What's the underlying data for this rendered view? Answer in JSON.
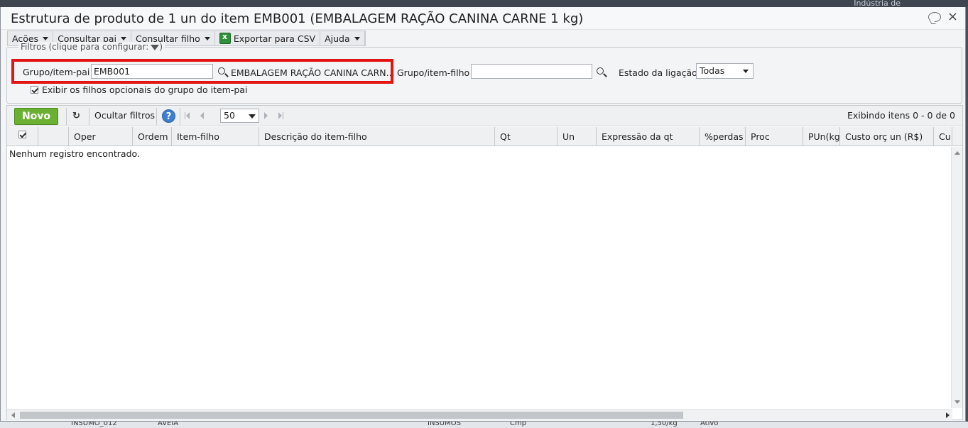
{
  "background": {
    "top_right_text": "Indústria de",
    "bottom_row": [
      "INSUMO_012",
      "AVEIA",
      "INSUMOS",
      "Cmp",
      "1,50/kg",
      "Ativo"
    ]
  },
  "dialog": {
    "title": "Estrutura de produto de 1 un do item EMB001 (EMBALAGEM RAÇÃO CANINA CARNE 1 kg)",
    "close_label": "×"
  },
  "menubar": {
    "acoes": "Ações",
    "consultar_pai": "Consultar pai",
    "consultar_filho": "Consultar filho",
    "exportar_csv": "Exportar para CSV",
    "ajuda": "Ajuda"
  },
  "filters": {
    "legend": "Filtros (clique para configurar:",
    "legend_end": ")",
    "grupo_pai_label": "Grupo/item-pai",
    "grupo_pai_value": "EMB001",
    "grupo_pai_desc": "EMBALAGEM RAÇÃO CANINA CARN...",
    "grupo_filho_label": "Grupo/item-filho",
    "grupo_filho_value": "",
    "estado_label": "Estado da ligação",
    "estado_value": "Todas",
    "exibir_label": "Exibir os filhos opcionais do grupo do item-pai",
    "exibir_checked": true
  },
  "toolbar": {
    "novo": "Novo",
    "ocultar_filtros": "Ocultar filtros",
    "help": "?",
    "page_size": "50",
    "showing": "Exibindo itens 0 - 0 de 0"
  },
  "table": {
    "columns": [
      "Oper",
      "Ordem",
      "Item-filho",
      "Descrição do item-filho",
      "Qt",
      "Un",
      "Expressão da qt",
      "%perdas",
      "Proc",
      "PUn(kg)",
      "Custo orç un (R$)",
      "Cu"
    ],
    "empty_message": "Nenhum registro encontrado."
  },
  "colors": {
    "highlight": "#e21414",
    "novo_button": "#6cb033",
    "help_icon": "#3d7ed1"
  }
}
